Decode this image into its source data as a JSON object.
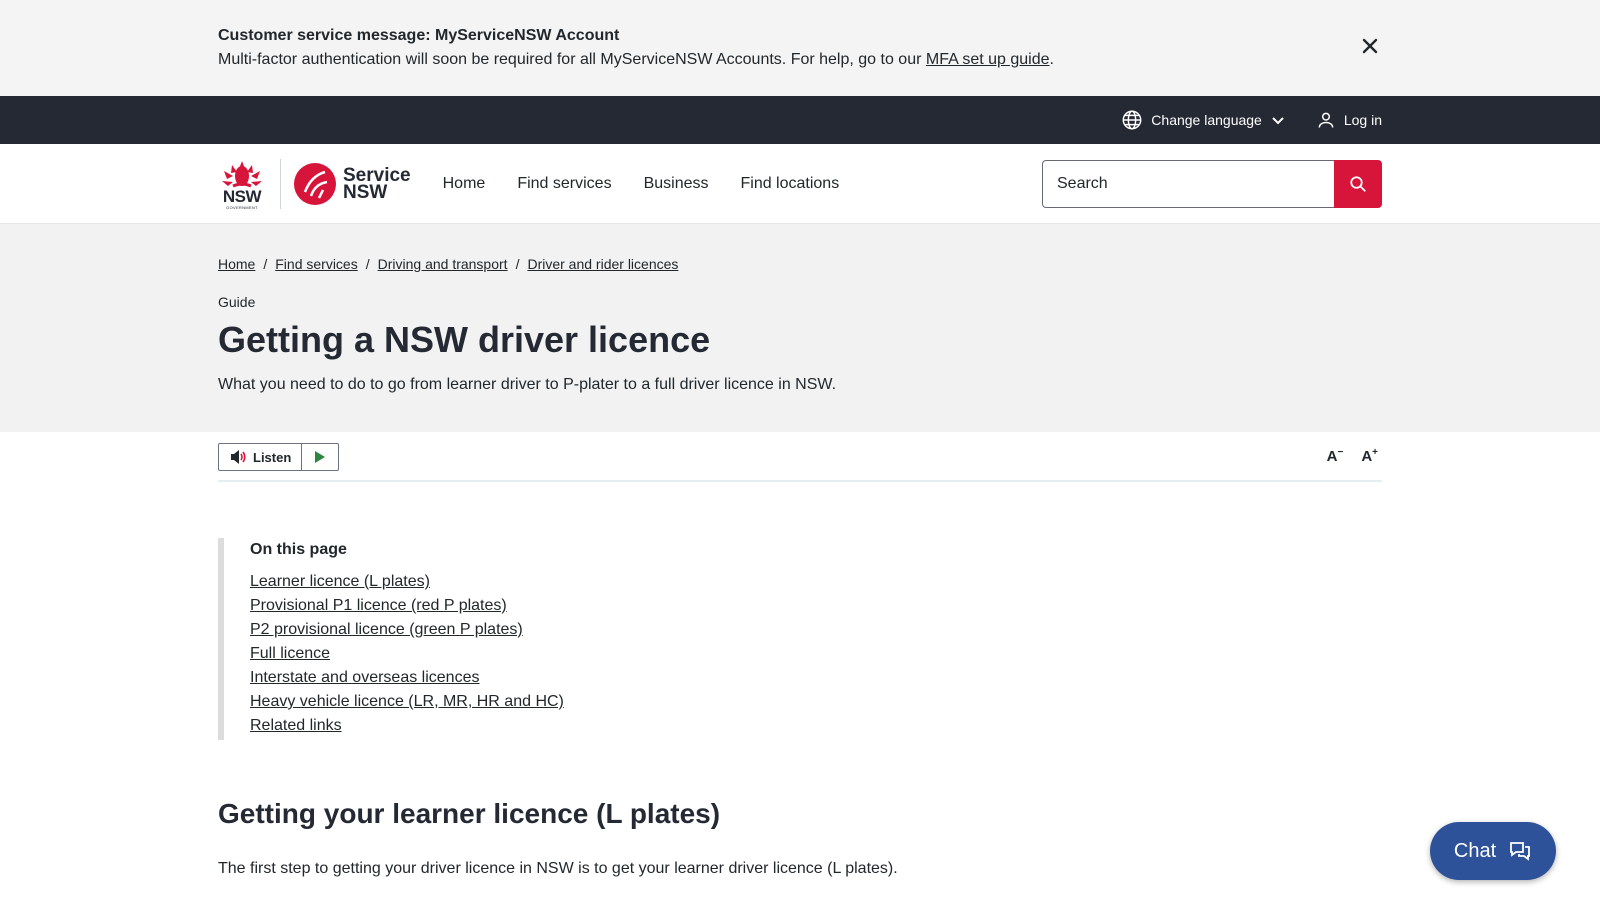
{
  "alert": {
    "title_prefix": "Customer service message",
    "title_suffix": ": MyServiceNSW Account",
    "body": "Multi-factor authentication will soon be required for all MyServiceNSW Accounts.  For help, go to our ",
    "link": "MFA set up guide",
    "body_end": "."
  },
  "topbar": {
    "language": "Change language",
    "login": "Log in"
  },
  "header": {
    "logo_nsw": "NSW",
    "logo_gov": "GOVERNMENT",
    "logo_service_1": "Service",
    "logo_service_2": "NSW",
    "nav": [
      "Home",
      "Find services",
      "Business",
      "Find locations"
    ],
    "search_placeholder": "Search"
  },
  "breadcrumb": [
    "Home",
    "Find services",
    "Driving and transport",
    "Driver and rider licences"
  ],
  "hero": {
    "eyebrow": "Guide",
    "title": "Getting a NSW driver licence",
    "intro": "What you need to do to go from learner driver to P-plater to a full driver licence in NSW."
  },
  "tools": {
    "listen": "Listen",
    "decrease": "A",
    "increase": "A"
  },
  "toc": {
    "title": "On this page",
    "items": [
      "Learner licence (L plates)",
      "Provisional P1 licence (red P plates)",
      "P2 provisional licence (green P plates)",
      "Full licence",
      "Interstate and overseas licences",
      "Heavy vehicle licence (LR, MR, HR and HC)",
      "Related links"
    ]
  },
  "section": {
    "title": "Getting your learner licence (L plates)",
    "body": "The first step to getting your driver licence in NSW is to get your learner driver licence (L plates)."
  },
  "chat": {
    "label": "Chat"
  },
  "colors": {
    "brand_red": "#d7153a",
    "topbar": "#242934",
    "chat": "#2e5299"
  }
}
